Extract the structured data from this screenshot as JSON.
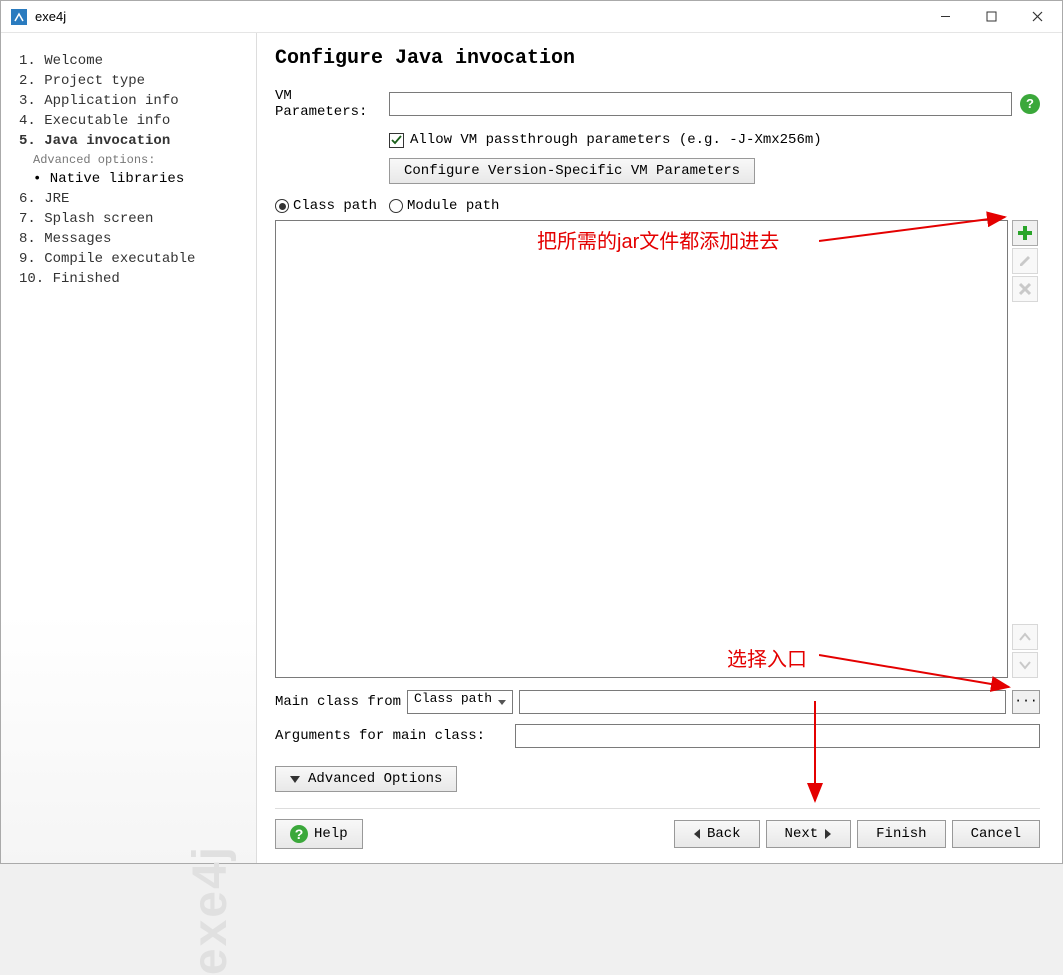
{
  "window": {
    "title": "exe4j"
  },
  "sidebar": {
    "steps": [
      "1. Welcome",
      "2. Project type",
      "3. Application info",
      "4. Executable info",
      "5. Java invocation",
      "6. JRE",
      "7. Splash screen",
      "8. Messages",
      "9. Compile executable",
      "10. Finished"
    ],
    "current_index": 4,
    "substep_header": "Advanced options:",
    "substep": "• Native libraries",
    "watermark": "exe4j"
  },
  "main": {
    "heading": "Configure Java invocation",
    "vm_label": "VM Parameters:",
    "vm_value": "",
    "allow_passthrough_label": "Allow VM passthrough parameters (e.g. -J-Xmx256m)",
    "allow_passthrough_checked": true,
    "config_version_btn": "Configure Version-Specific VM Parameters",
    "radio_classpath": "Class path",
    "radio_modulepath": "Module path",
    "radio_selection": "classpath",
    "main_class_label": "Main class from",
    "main_class_select": "Class path",
    "main_class_value": "",
    "args_label": "Arguments for main class:",
    "args_value": "",
    "advanced_btn": "Advanced Options"
  },
  "footer": {
    "help": "Help",
    "back": "Back",
    "next": "Next",
    "finish": "Finish",
    "cancel": "Cancel"
  },
  "annotations": {
    "jar_hint": "把所需的jar文件都添加进去",
    "entry_hint": "选择入口"
  },
  "icons": {
    "add": "add-icon",
    "edit": "edit-icon",
    "delete": "delete-icon",
    "up": "up-icon",
    "down": "down-icon"
  }
}
